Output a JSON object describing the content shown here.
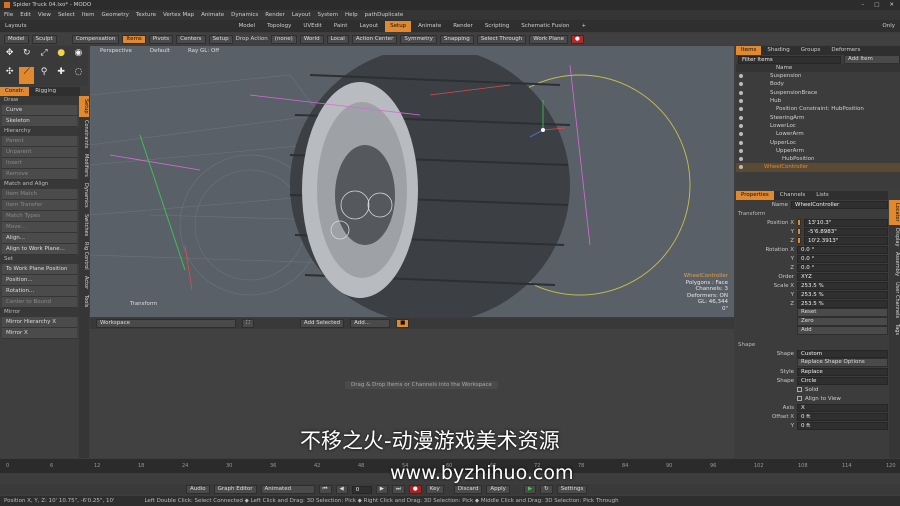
{
  "window": {
    "title": "Spider Truck 04.lxo* - MODO",
    "controls": [
      "–",
      "□",
      "✕"
    ]
  },
  "menu": [
    "File",
    "Edit",
    "View",
    "Select",
    "Item",
    "Geometry",
    "Texture",
    "Vertex Map",
    "Animate",
    "Dynamics",
    "Render",
    "Layout",
    "System",
    "Help",
    "pathDuplicate"
  ],
  "layout_tabs": {
    "layouts": "Layouts",
    "tabs": [
      "Model",
      "Topology",
      "UVEdit",
      "Paint",
      "Layout",
      "Setup",
      "Animate",
      "Render",
      "Scripting",
      "Schematic Fusion"
    ],
    "add": "+",
    "only": "Only"
  },
  "toolbar": {
    "model": "Model",
    "sculpt": "Sculpt",
    "compensation": "Compensation",
    "items": [
      "Items",
      "Pivots",
      "Centers",
      "Setup"
    ],
    "drop_action_label": "Drop Action",
    "drop_action_value": "(none)",
    "world": "World",
    "local": "Local",
    "action_center": "Action Center",
    "symmetry": "Symmetry",
    "snapping": "Snapping",
    "select_through": "Select Through",
    "work_plane": "Work Plane"
  },
  "viewport": {
    "view": "Perspective",
    "shade": "Default",
    "ray": "Ray GL: Off",
    "info": [
      "WheelController",
      "Polygons : Face",
      "Channels: 3",
      "Deformers: ON",
      "GL: 46,344",
      "0\""
    ],
    "transform_label": "Transform"
  },
  "left_tabs": {
    "tabs": [
      "Constr.",
      "Rigging"
    ],
    "side": [
      "Setup",
      "Constraints",
      "Modifiers",
      "Dynamics",
      "Switches",
      "Rig Control",
      "Actor",
      "Tools"
    ]
  },
  "left_panel": [
    {
      "h": "Draw"
    },
    {
      "b": "Curve"
    },
    {
      "b": "Skeleton"
    },
    {
      "h": "Hierarchy"
    },
    {
      "b": "Parent",
      "d": true
    },
    {
      "b": "Unparent",
      "d": true
    },
    {
      "b": "Insert",
      "d": true
    },
    {
      "b": "Remove",
      "d": true
    },
    {
      "h": "Match and Align"
    },
    {
      "b": "Item Match",
      "d": true
    },
    {
      "b": "Item Transfer",
      "d": true
    },
    {
      "b": "Match Types",
      "d": true
    },
    {
      "b": "Move...",
      "d": true
    },
    {
      "b": "Align..."
    },
    {
      "b": "Align to Work Plane..."
    },
    {
      "h": "Set"
    },
    {
      "b": "To Work Plane Position"
    },
    {
      "b": "Position..."
    },
    {
      "b": "Rotation..."
    },
    {
      "b": "Center to Bound",
      "d": true
    },
    {
      "h": "Mirror"
    },
    {
      "b": "Mirror Hierarchy X"
    },
    {
      "b": "Mirror X"
    }
  ],
  "workspace": {
    "name": "Workspace",
    "add_selected": "Add Selected",
    "add": "Add...",
    "hint": "Drag & Drop Items or Channels into the Workspace"
  },
  "right_top": {
    "tabs": [
      "Items",
      "Shading",
      "Groups",
      "Deformers"
    ],
    "filter": "Filter Items",
    "add_item": "Add Item",
    "col_name": "Name",
    "items": [
      {
        "n": "Suspension",
        "d": 4
      },
      {
        "n": "Body",
        "d": 4
      },
      {
        "n": "SuspensionBrace",
        "d": 4
      },
      {
        "n": "Hub",
        "d": 4
      },
      {
        "n": "Position Constraint: HubPosition",
        "d": 5
      },
      {
        "n": "SteeringArm",
        "d": 4
      },
      {
        "n": "LowerLoc",
        "d": 4
      },
      {
        "n": "LowerArm",
        "d": 5
      },
      {
        "n": "UpperLoc",
        "d": 4
      },
      {
        "n": "UpperArm",
        "d": 5
      },
      {
        "n": "HubPosition",
        "d": 6
      },
      {
        "n": "WheelController",
        "d": 3,
        "sel": true
      }
    ]
  },
  "props": {
    "tabs": [
      "Properties",
      "Channels",
      "Lists"
    ],
    "side": [
      "Locator",
      "Display",
      "Assembly",
      "User Channels",
      "Tags"
    ],
    "name_label": "Name",
    "name": "WheelController",
    "transform": "Transform",
    "position": {
      "label": "Position X",
      "y": "Y",
      "z": "Z",
      "x_val": "13'10.3\"",
      "y_val": "-5'6.8983\"",
      "z_val": "10'2.3913\""
    },
    "rotation": {
      "label": "Rotation X",
      "x_val": "0.0 °",
      "y_val": "0.0 °",
      "z_val": "0.0 °"
    },
    "order": {
      "label": "Order",
      "val": "XYZ"
    },
    "scale": {
      "label": "Scale X",
      "x_val": "253.5 %",
      "y_val": "253.5 %",
      "z_val": "253.5 %"
    },
    "actions": [
      "Reset",
      "Zero",
      "Add"
    ],
    "shape": "Shape",
    "shape_label": "Shape",
    "shape_val": "Custom",
    "replace_btn": "Replace Shape Options",
    "style_label": "Style",
    "style_val": "Replace",
    "shape2_label": "Shape",
    "shape2_val": "Circle",
    "solid": "Solid",
    "align_view": "Align to View",
    "axis_label": "Axis",
    "axis_val": "X",
    "offset_label": "Offset X",
    "offset_x": "0 ft",
    "offset_y": "0 ft"
  },
  "timeline": {
    "ticks": [
      "0",
      "6",
      "12",
      "18",
      "24",
      "30",
      "36",
      "42",
      "48",
      "54",
      "60",
      "66",
      "72",
      "78",
      "84",
      "90",
      "96",
      "102",
      "108",
      "114",
      "120"
    ],
    "end": "120"
  },
  "transport": {
    "audio": "Audio",
    "graph_editor": "Graph Editor",
    "animated": "Animated",
    "frame": "0",
    "keys": "Key",
    "discard": "Discard",
    "apply": "Apply",
    "settings": "Settings"
  },
  "status": {
    "left": "Position X, Y, Z:  10' 10.75\",  -6'0.25\",  10'",
    "hints": "Left Double Click: Select Connected ◆ Left Click and Drag: 3D Selection: Pick ◆ Right Click and Drag: 3D Selection: Pick ◆ Middle Click and Drag: 3D Selection: Pick Through"
  },
  "watermark": {
    "cn": "不移之火-动漫游戏美术资源",
    "url": "www.byzhihuo.com"
  },
  "colors": {
    "accent": "#e0892f",
    "bg": "#3d3d3d",
    "viewport": "#5a6068",
    "selected_row": "#e0892f"
  }
}
